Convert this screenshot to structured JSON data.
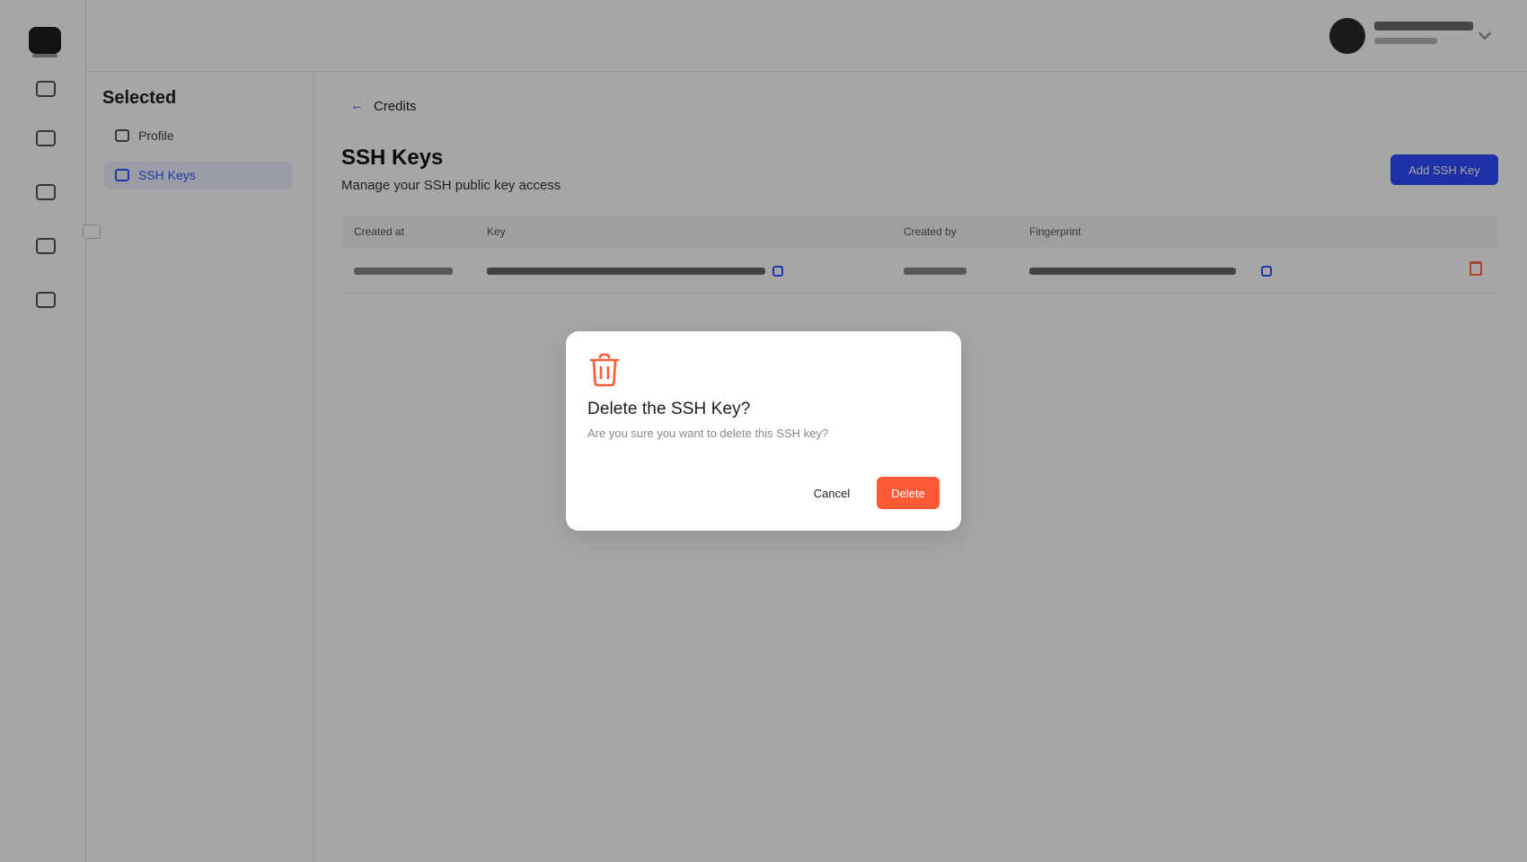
{
  "subnav": {
    "title": "Selected",
    "items": [
      {
        "label": "Profile"
      },
      {
        "label": "SSH Keys"
      }
    ]
  },
  "main": {
    "back_label": "Credits",
    "title": "SSH Keys",
    "subtitle": "Manage your SSH public key access",
    "add_button": "Add SSH Key",
    "table": {
      "headers": [
        "Created at",
        "Key",
        "Created by",
        "Fingerprint"
      ]
    }
  },
  "modal": {
    "icon": "trash-icon",
    "title": "Delete the SSH Key?",
    "description": "Are you sure you want to delete this SSH key?",
    "cancel_label": "Cancel",
    "delete_label": "Delete",
    "accent_color": "#ff5a36"
  },
  "colors": {
    "primary": "#2d4bff",
    "danger": "#ff5a36"
  }
}
